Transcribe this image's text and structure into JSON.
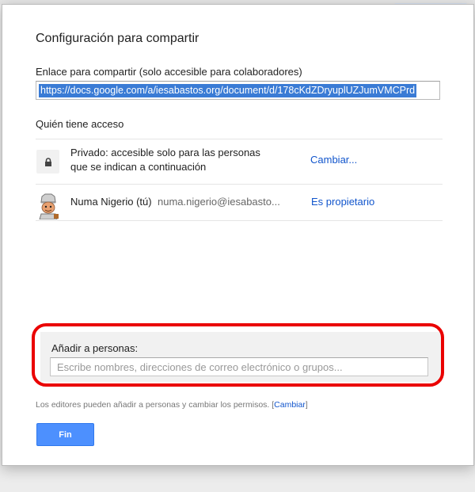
{
  "dialog": {
    "title": "Configuración para compartir",
    "link_label": "Enlace para compartir (solo accesible para colaboradores)",
    "link_value": "https://docs.google.com/a/iesabastos.org/document/d/178cKdZDryuplUZJumVMCPrd",
    "access_heading": "Quién tiene acceso",
    "privacy": {
      "icon": "lock-icon",
      "line1": "Privado: accesible solo para las personas",
      "line2": "que se indican a continuación",
      "change_link": "Cambiar..."
    },
    "owner": {
      "avatar": "user-avatar",
      "name": "Numa Nigerio (tú)",
      "email": "numa.nigerio@iesabasto...",
      "role": "Es propietario"
    },
    "add_people": {
      "label": "Añadir a personas:",
      "placeholder": "Escribe nombres, direcciones de correo electrónico o grupos..."
    },
    "footnote": {
      "text": "Los editores pueden añadir a personas y cambiar los permisos.",
      "bracket_open": "[",
      "link": "Cambiar",
      "bracket_close": "]"
    },
    "done_button": "Fin"
  },
  "colors": {
    "accent_blue": "#4d90fe",
    "link_blue": "#1155cc",
    "highlight_red": "#ea0000"
  }
}
